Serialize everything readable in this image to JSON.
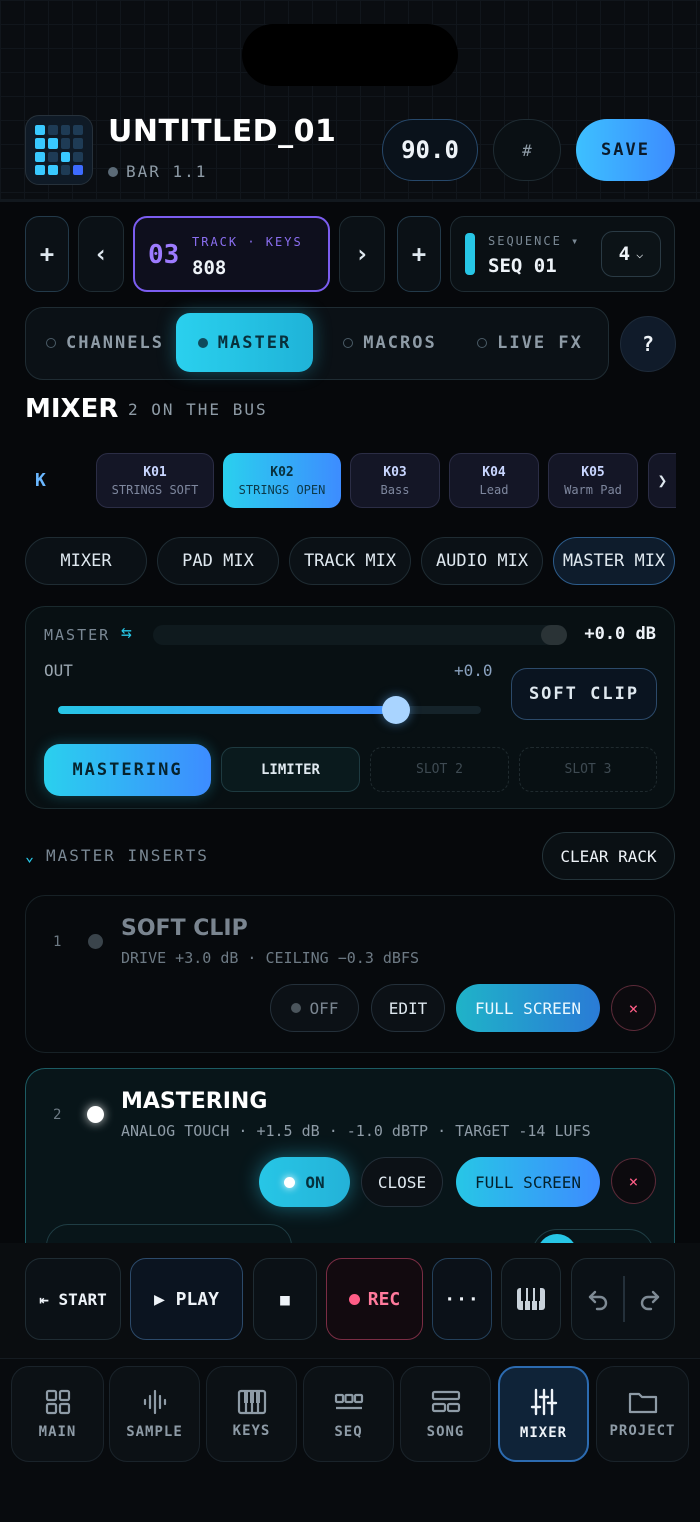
{
  "header": {
    "title": "UNTITLED_01",
    "bar_label": "BAR 1.1",
    "tempo": "90.0",
    "tap_icon": "hash-icon",
    "save_label": "SAVE"
  },
  "track": {
    "add_label": "+",
    "prev_label": "‹",
    "next_label": "›",
    "number": "03",
    "kind_label": "TRACK · KEYS",
    "name": "808",
    "add2_label": "+"
  },
  "sequence": {
    "label": "SEQUENCE ▾",
    "name": "SEQ 01",
    "count": "4"
  },
  "view_tabs": [
    {
      "label": "CHANNELS",
      "active": false
    },
    {
      "label": "MASTER",
      "active": true
    },
    {
      "label": "MACROS",
      "active": false
    },
    {
      "label": "LIVE FX",
      "active": false
    }
  ],
  "help_label": "?",
  "mixer": {
    "title": "MIXER",
    "subtitle": "2 ON THE BUS",
    "kit_prefix": "K",
    "kits": [
      {
        "id": "K01",
        "name": "STRINGS SOFT",
        "active": false
      },
      {
        "id": "K02",
        "name": "STRINGS OPEN",
        "active": true
      },
      {
        "id": "K03",
        "name": "Bass",
        "active": false
      },
      {
        "id": "K04",
        "name": "Lead",
        "active": false
      },
      {
        "id": "K05",
        "name": "Warm Pad",
        "active": false
      }
    ],
    "kit_more": "❯"
  },
  "mix_tabs": [
    {
      "label": "MIXER",
      "active": false
    },
    {
      "label": "PAD MIX",
      "active": false
    },
    {
      "label": "TRACK MIX",
      "active": false
    },
    {
      "label": "AUDIO MIX",
      "active": false
    },
    {
      "label": "MASTER MIX",
      "active": true
    }
  ],
  "master": {
    "label": "MASTER",
    "meter_value": "+0.0 dB",
    "out_label": "OUT",
    "out_value": "+0.0",
    "out_level": 0.8,
    "soft_clip_label": "SOFT CLIP",
    "slots": [
      "MASTERING",
      "LIMITER",
      "SLOT 2",
      "SLOT 3"
    ]
  },
  "inserts": {
    "title": "MASTER INSERTS",
    "clear_label": "CLEAR RACK",
    "items": [
      {
        "index": "1",
        "name": "SOFT CLIP",
        "detail": "DRIVE +3.0 dB · CEILING −0.3 dBFS",
        "state": "OFF",
        "edit": "EDIT",
        "full": "FULL SCREEN",
        "remove": "×"
      },
      {
        "index": "2",
        "name": "MASTERING",
        "detail": "ANALOG TOUCH · +1.5 dB · -1.0 dBTP · TARGET -14 LUFS",
        "state": "ON",
        "edit": "CLOSE",
        "full": "FULL SCREEN",
        "remove": "×"
      }
    ]
  },
  "transport": {
    "start_label": "⇤ START",
    "play_label": "▶ PLAY",
    "stop_label": "■",
    "rec_label": "REC",
    "more_label": "···"
  },
  "nav": [
    {
      "label": "MAIN",
      "icon": "grid-icon",
      "active": false
    },
    {
      "label": "SAMPLE",
      "icon": "waveform-icon",
      "active": false
    },
    {
      "label": "KEYS",
      "icon": "piano-icon",
      "active": false
    },
    {
      "label": "SEQ",
      "icon": "sequencer-icon",
      "active": false
    },
    {
      "label": "SONG",
      "icon": "song-icon",
      "active": false
    },
    {
      "label": "MIXER",
      "icon": "sliders-icon",
      "active": true
    },
    {
      "label": "PROJECT",
      "icon": "folder-icon",
      "active": false
    }
  ],
  "colors": {
    "accent": "#27c6e6",
    "accent2": "#3d8cff",
    "track_accent": "#8d6bff",
    "rec": "#ff5d86",
    "bg": "#06080b"
  }
}
